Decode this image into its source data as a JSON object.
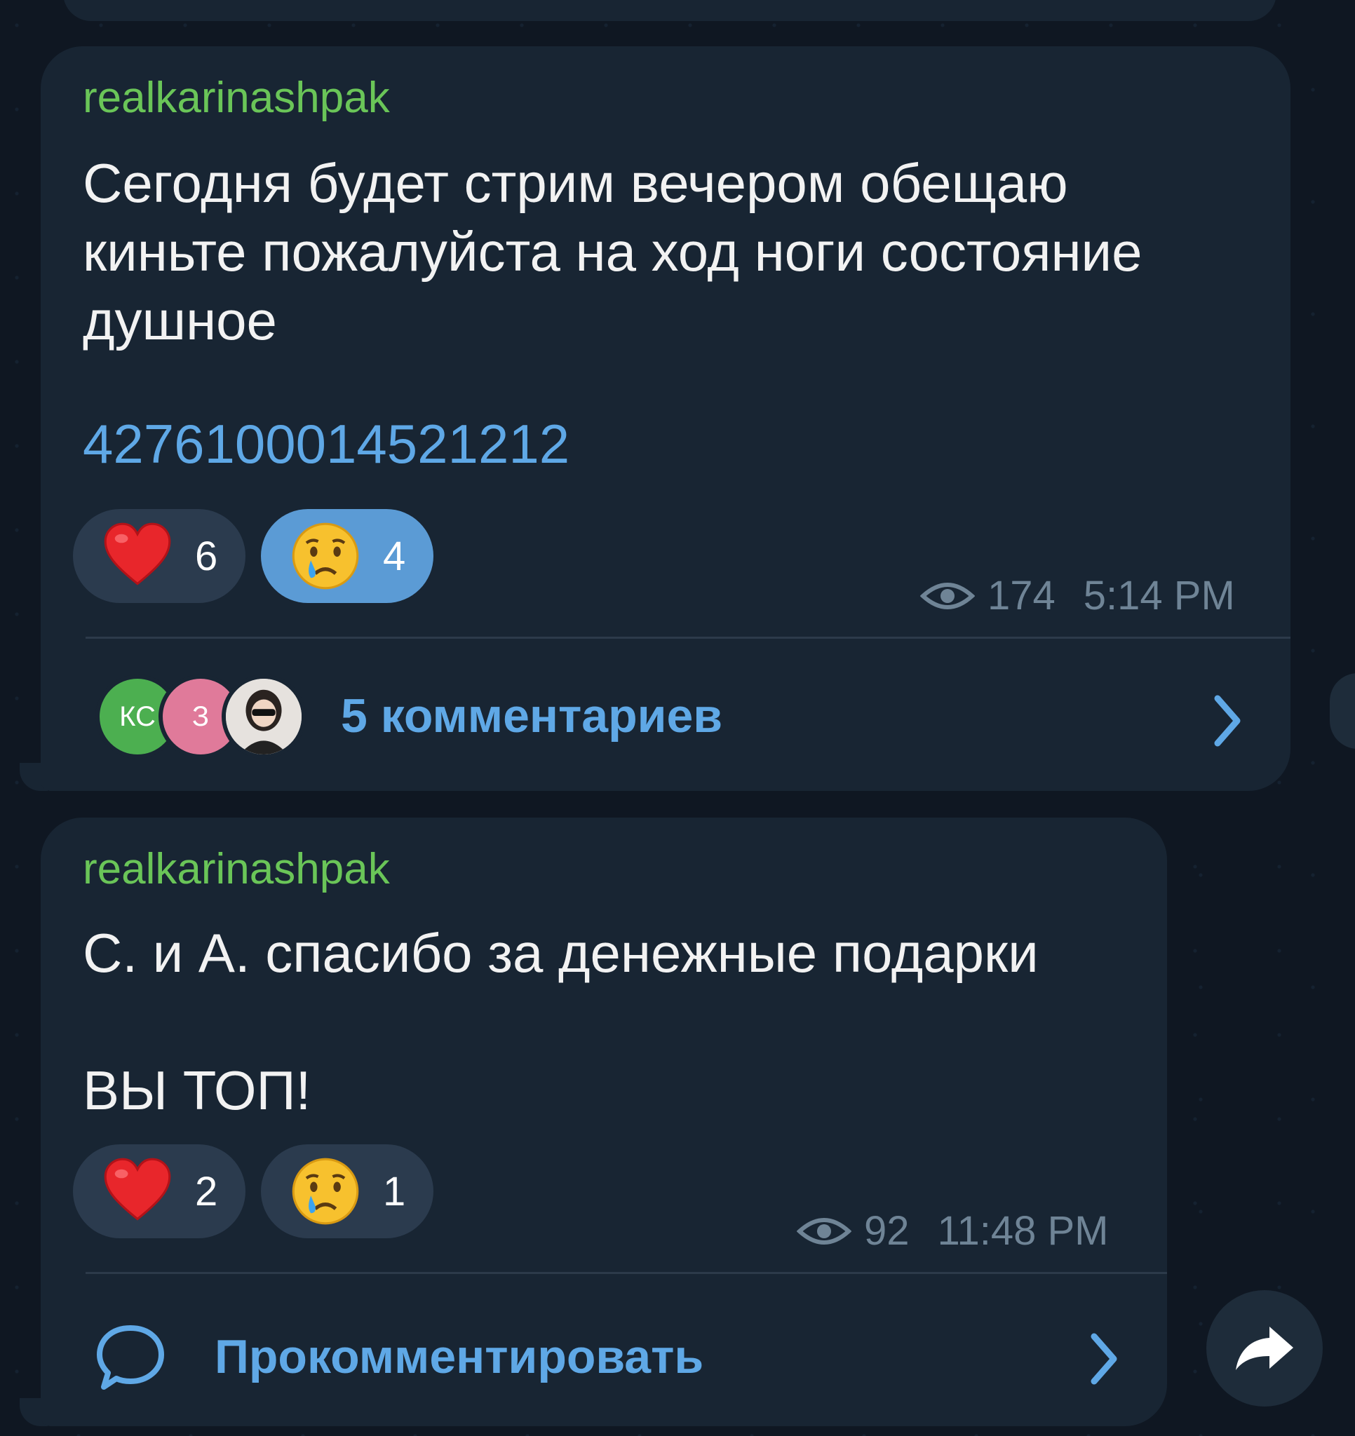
{
  "colors": {
    "background": "#0f1722",
    "bubble": "#182533",
    "author": "#6ac558",
    "link": "#5fa8e6",
    "meta": "#6f8496",
    "reaction_bg": "#2b3b4e",
    "reaction_active_bg": "#5b9bd5"
  },
  "posts": [
    {
      "author": "realkarinashpak",
      "text": "Сегодня будет стрим вечером обещаю\nкиньте пожалуйста на ход ноги состояние\nдушное",
      "link_number": "4276100014521212",
      "reactions": [
        {
          "icon": "heart-emoji",
          "count": "6",
          "active": false
        },
        {
          "icon": "crying-face-emoji",
          "count": "4",
          "active": true
        }
      ],
      "views": "174",
      "time": "5:14 PM",
      "comments": {
        "avatars": [
          {
            "initials": "КС",
            "color": "#4caf50"
          },
          {
            "initials": "З",
            "color": "#e07a9a"
          },
          {
            "icon": "photo-avatar"
          }
        ],
        "label": "5 комментариев"
      }
    },
    {
      "author": "realkarinashpak",
      "text": "С. и А. спасибо за денежные подарки\n\nВЫ ТОП!",
      "reactions": [
        {
          "icon": "heart-emoji",
          "count": "2",
          "active": false
        },
        {
          "icon": "crying-face-emoji",
          "count": "1",
          "active": false
        }
      ],
      "views": "92",
      "time": "11:48 PM",
      "comments": {
        "icon": "comment-bubble-icon",
        "label": "Прокомментировать"
      }
    }
  ]
}
